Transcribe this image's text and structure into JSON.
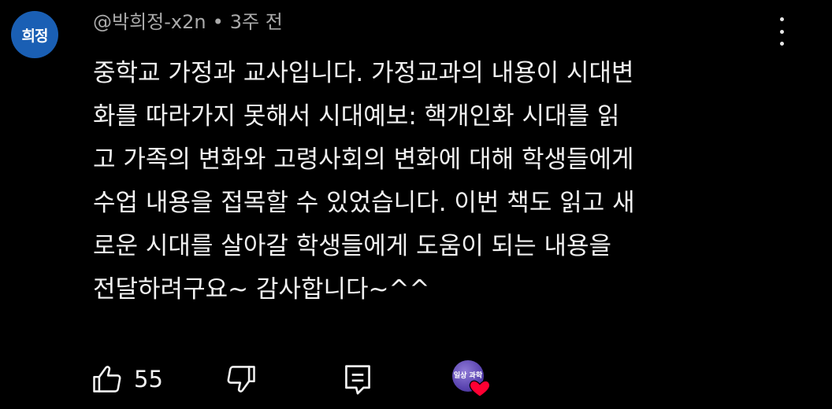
{
  "avatar": {
    "label": "희정",
    "color": "#1a5fb4"
  },
  "comment": {
    "author": "@박희정-x2n",
    "separator": "•",
    "timestamp": "3주 전",
    "lines": [
      "중학교 가정과 교사입니다. 가정교과의 내용이 시대변",
      "화를 따라가지 못해서 시대예보: 핵개인화 시대를 읽",
      "고 가족의 변화와 고령사회의 변화에 대해 학생들에게",
      "수업 내용을 접목할 수 있었습니다. 이번 책도 읽고 새",
      "로운 시대를 살아갈 학생들에게 도움이 되는 내용을",
      "전달하려구요~  감사합니다~^^"
    ]
  },
  "actions": {
    "like_count": "55",
    "like_icon": "thumbs-up-icon",
    "dislike_icon": "thumbs-down-icon",
    "reply_icon": "comment-icon",
    "more_icon": "more-vertical-icon",
    "creator_heart_icon": "heart-icon",
    "creator_avatar_text": "일상 과학",
    "heart_color": "#ff0033"
  }
}
